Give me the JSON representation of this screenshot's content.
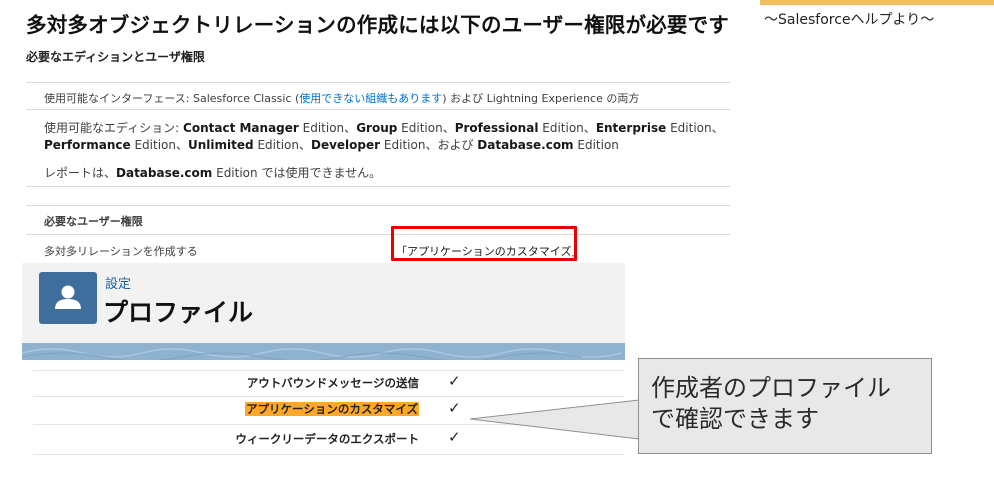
{
  "header": {
    "title": "多対多オブジェクトリレーションの作成には以下のユーザー権限が必要です",
    "source_note": "〜Salesforceヘルプより〜"
  },
  "editions": {
    "section_title": "必要なエディションとユーザ権限",
    "interface_prefix": "使用可能なインターフェース: Salesforce Classic (",
    "interface_link": "使用できない組織もあります",
    "interface_suffix": ") および Lightning Experience の両方",
    "available_prefix": "使用可能なエディション: ",
    "available_items": [
      "Contact Manager",
      "Group",
      "Professional",
      "Enterprise",
      "Performance",
      "Unlimited",
      "Developer",
      "Database.com"
    ],
    "edition_word": "Edition",
    "sep": "、",
    "and_word": "および ",
    "report_prefix": "レポートは、",
    "report_bold": "Database.com",
    "report_suffix": " Edition では使用できません。"
  },
  "permissions": {
    "header": "必要なユーザー権限",
    "row_label": "多対多リレーションを作成する",
    "row_value": "「アプリケーションのカスタマイズ」"
  },
  "profile": {
    "breadcrumb": "設定",
    "title": "プロファイル",
    "icon": "user-icon",
    "items": [
      {
        "label": "アウトバウンドメッセージの送信",
        "highlighted": false,
        "checked": true
      },
      {
        "label": "アプリケーションのカスタマイズ",
        "highlighted": true,
        "checked": true
      },
      {
        "label": "ウィークリーデータのエクスポート",
        "highlighted": false,
        "checked": true
      }
    ],
    "check_glyph": "✓"
  },
  "callout": {
    "line1": "作成者のプロファイル",
    "line2": "で確認できます"
  },
  "colors": {
    "red_box": "#ea0000",
    "highlight": "#ffa726",
    "link": "#0070d2"
  }
}
